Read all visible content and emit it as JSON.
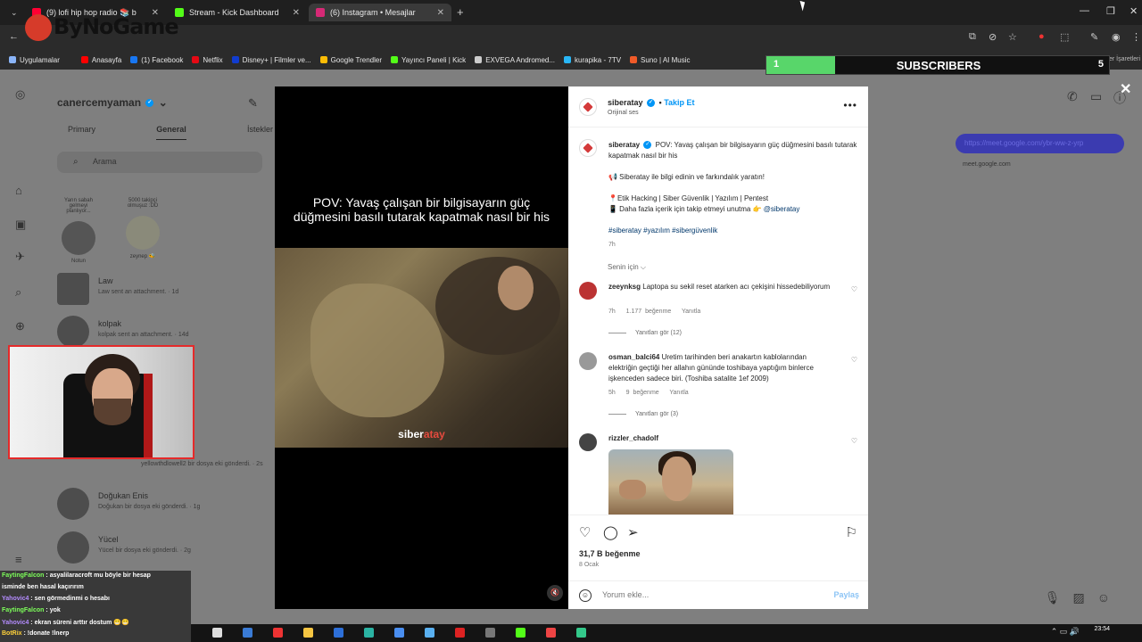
{
  "browser": {
    "tabs": [
      {
        "label": "(9) lofi hip hop radio 📚 b",
        "color": "#ff0033",
        "active": false
      },
      {
        "label": "Stream - Kick Dashboard",
        "color": "#53fc18",
        "active": false
      },
      {
        "label": "(6) Instagram • Mesajlar",
        "color": "#d62976",
        "active": true
      }
    ],
    "address_fragment": "instagram.com/direct",
    "bookmarks": [
      {
        "label": "Uygulamalar",
        "color": "#8ab4f8"
      },
      {
        "label": "Anasayfa",
        "color": "#ff0000"
      },
      {
        "label": "(1) Facebook",
        "color": "#1877f2"
      },
      {
        "label": "Netflix",
        "color": "#e50914"
      },
      {
        "label": "Disney+ | Filmler ve...",
        "color": "#113ccf"
      },
      {
        "label": "Google Trendler",
        "color": "#fbbc05"
      },
      {
        "label": "Yayıncı Paneli | Kick",
        "color": "#53fc18"
      },
      {
        "label": "EXVEGA Andromed...",
        "color": "#cccccc"
      },
      {
        "label": "kurapika - 7TV",
        "color": "#29b6f6"
      },
      {
        "label": "Suno | AI Music",
        "color": "#f05a28"
      }
    ],
    "other_bookmarks": "Tüm Yer İşaretleri"
  },
  "stream_overlay": {
    "logo_text": "ByNoGame",
    "subs_current": "1",
    "subs_label": "SUBSCRIBERS",
    "subs_goal": "5",
    "subs_progress": 0.2
  },
  "inbox": {
    "username": "canercemyaman",
    "tabs": [
      "Primary",
      "General",
      "İstekler"
    ],
    "selected_tab": "General",
    "search_placeholder": "Arama",
    "notes": [
      {
        "caption": "Notun",
        "bubble": "Yarın sabah gelmeyi planlıyor..."
      },
      {
        "caption": "zeynep 🐝",
        "bubble": "5000 takipçi olmuşuz :DD"
      }
    ],
    "conversations": [
      {
        "name": "Law",
        "message": "Law sent an attachment. · 1d"
      },
      {
        "name": "kolpak",
        "message": "kolpak sent an attachment. · 14d"
      },
      {
        "name": "Doğukan Enis",
        "message": "Doğukan bir dosya eki gönderdi. · 1g"
      },
      {
        "name": "Yücel",
        "message": "Yücel bir dosya eki gönderdi. · 2g"
      }
    ],
    "partial_message": "yellowthdlowell2 bir dosya eki gönderdi. · 2s",
    "meet_link_text": "meet.google.com",
    "meet_bubble": "https://meet.google.com/ybr-ww-z-yrp"
  },
  "post": {
    "video_caption": "POV: Yavaş çalışan bir bilgisayarın güç düğmesini basılı tutarak kapatmak nasıl bir his",
    "watermark_a": "siber",
    "watermark_b": "atay",
    "author": "siberatay",
    "follow_label": "Takip Et",
    "audio": "Orijinal ses",
    "caption_line1": "POV: Yavaş çalışan bir bilgisayarın güç düğmesini basılı tutarak kapatmak nasıl bir his",
    "caption_line2": "📢 Siberatay ile bilgi edinin ve farkındalık yaratın!",
    "caption_line3": "📍Etik Hacking | Siber Güvenlik | Yazılım | Pentest",
    "caption_line4": "📱 Daha fazla içerik için takip etmeyi unutma 👉",
    "caption_mention": "@siberatay",
    "hashtags": "#siberatay #yazılım #sibergüvenlik",
    "caption_time": "7h",
    "for_you": "Senin için ⌵",
    "comments": [
      {
        "user": "zeeynksg",
        "text": "Laptopa su sekil reset atarken acı çekişini hissedebiliyorum",
        "time": "7h",
        "likes": "1.177 beğenme",
        "reply": "Yanıtla",
        "view_replies": "Yanıtları gör (12)"
      },
      {
        "user": "osman_balci64",
        "text": "Uretim tarihinden beri anakartın kablolarından elektriğin geçtiği her allahın gününde toshibaya yaptığım binlerce işkenceden sadece biri. (Toshiba satalite 1ef 2009)",
        "time": "5h",
        "likes": "9 beğenme",
        "reply": "Yanıtla",
        "view_replies": "Yanıtları gör (3)"
      },
      {
        "user": "rizzler_chadolf",
        "text": "",
        "time": "",
        "likes": "",
        "reply": "",
        "view_replies": ""
      }
    ],
    "like_count": "31,7 B beğenme",
    "date": "8 Ocak",
    "comment_placeholder": "Yorum ekle...",
    "post_label": "Paylaş"
  },
  "chat": [
    {
      "user": "FaytingFalcon",
      "text": "asyalilaracroft mu böyle bir hesap",
      "style": "u"
    },
    {
      "user": "",
      "text": "isminde ben hasal kaçırırım",
      "style": ""
    },
    {
      "user": "Yahovic4",
      "text": "sen görmedinmi o hesabı",
      "style": "u3"
    },
    {
      "user": "FaytingFalcon",
      "text": "yok",
      "style": "u"
    },
    {
      "user": "Yahovic4",
      "text": "ekran süreni arttır dostum 😁😁",
      "style": "u3"
    },
    {
      "user": "BotRix",
      "text": "!donate !lnerp",
      "style": "u2"
    }
  ],
  "clock": "23:54"
}
